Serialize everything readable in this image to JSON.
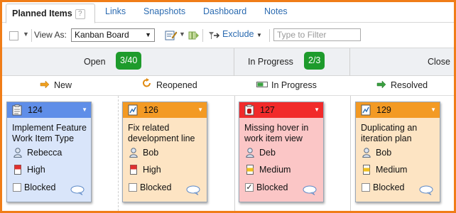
{
  "tabs": [
    {
      "label": "Planned Items",
      "active": true
    },
    {
      "label": "Links"
    },
    {
      "label": "Snapshots"
    },
    {
      "label": "Dashboard"
    },
    {
      "label": "Notes"
    }
  ],
  "help_glyph": "?",
  "toolbar": {
    "view_as_label": "View As:",
    "view_value": "Kanban Board",
    "exclude_label": "Exclude",
    "filter_placeholder": "Type to Filter"
  },
  "groups": [
    {
      "title": "Open",
      "count": "3/40"
    },
    {
      "title": "In Progress",
      "count": "2/3"
    },
    {
      "title": "Close"
    }
  ],
  "states": [
    {
      "label": "New",
      "icon": "arrow-right-icon"
    },
    {
      "label": "Reopened",
      "icon": "reopen-icon"
    },
    {
      "label": "In Progress",
      "icon": "progress-icon"
    },
    {
      "label": "Resolved",
      "icon": "resolved-arrow-icon"
    }
  ],
  "colors": {
    "accent": "#f07d18",
    "badge": "#1e9b2c",
    "link": "#2a6ab0"
  },
  "cards": [
    {
      "id": "124",
      "title": "Implement Feature Work Item Type",
      "owner": "Rebecca",
      "priority": "High",
      "blocked_label": "Blocked",
      "blocked": false,
      "head_color": "#5f8ee8",
      "body_color": "#d9e5fa",
      "type_icon": "task-icon"
    },
    {
      "id": "126",
      "title": "Fix related development line",
      "owner": "Bob",
      "priority": "High",
      "blocked_label": "Blocked",
      "blocked": false,
      "head_color": "#f39a24",
      "body_color": "#fde4c3",
      "type_icon": "task-icon"
    },
    {
      "id": "127",
      "title": "Missing hover in work item view",
      "owner": "Deb",
      "priority": "Medium",
      "blocked_label": "Blocked",
      "blocked": true,
      "head_color": "#f12a2a",
      "body_color": "#fbc6c6",
      "type_icon": "defect-icon"
    },
    {
      "id": "129",
      "title": "Duplicating an iteration plan",
      "owner": "Bob",
      "priority": "Medium",
      "blocked_label": "Blocked",
      "blocked": false,
      "head_color": "#f39a24",
      "body_color": "#fde4c3",
      "type_icon": "task-icon"
    }
  ]
}
